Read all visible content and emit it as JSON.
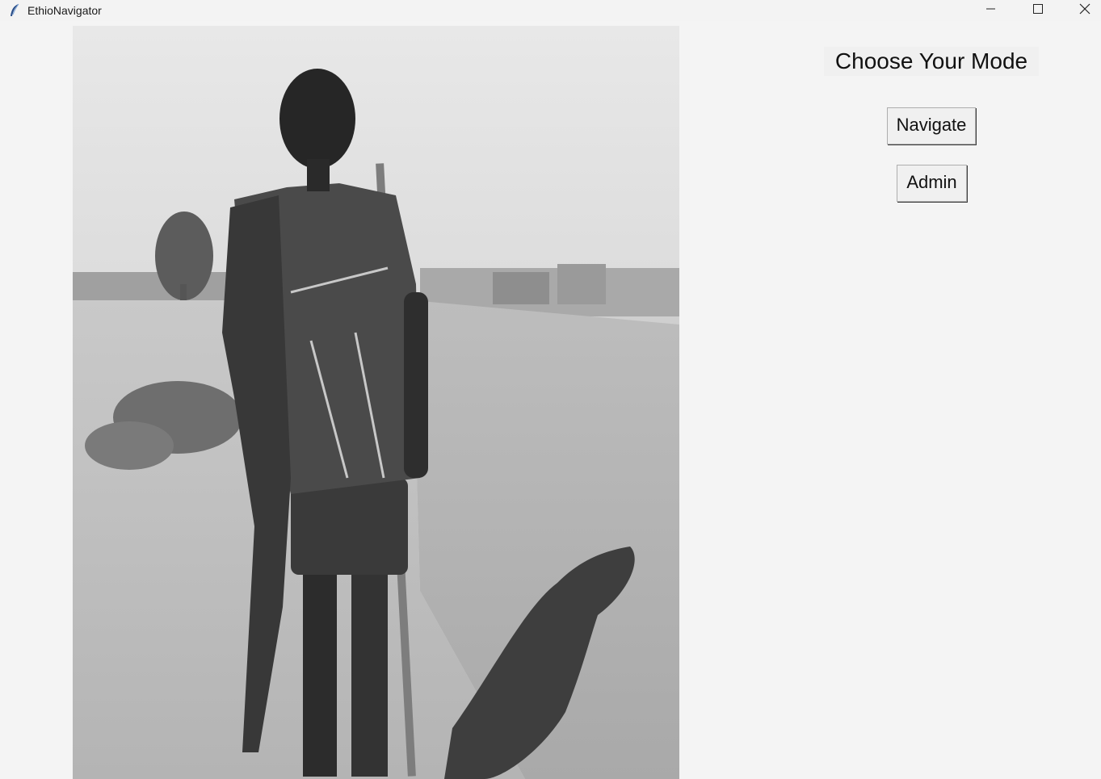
{
  "window": {
    "title": "EthioNavigator",
    "icon": "feather-icon",
    "controls": [
      "minimize-icon",
      "maximize-icon",
      "close-icon"
    ]
  },
  "main": {
    "heading": "Choose Your Mode",
    "buttons": {
      "navigate_label": "Navigate",
      "admin_label": "Admin"
    }
  },
  "colors": {
    "background": "#f4f4f4",
    "button_bg": "#f0f0f0",
    "button_border": "#adadad"
  }
}
